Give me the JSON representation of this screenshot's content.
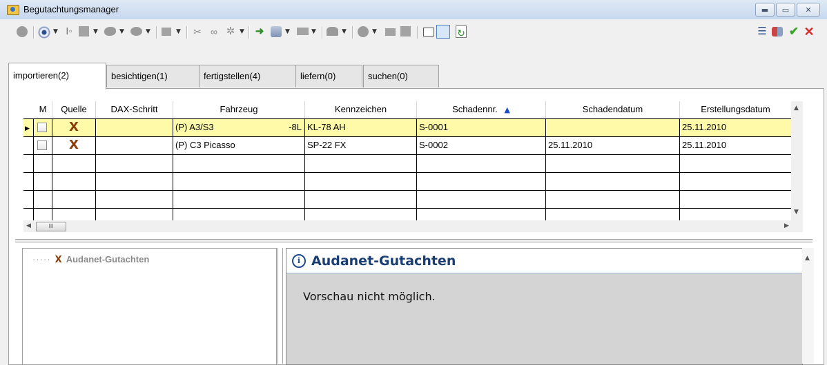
{
  "window": {
    "title": "Begutachtungsmanager",
    "buttons": [
      "minimize",
      "maximize",
      "close"
    ]
  },
  "tabs": [
    {
      "label": "importieren(2)",
      "active": true
    },
    {
      "label": "besichtigen(1)",
      "active": false
    },
    {
      "label": "fertigstellen(4)",
      "active": false
    },
    {
      "label": "liefern(0)",
      "active": false
    },
    {
      "label": "suchen(0)",
      "active": false
    }
  ],
  "grid": {
    "columns": [
      "M",
      "Quelle",
      "DAX-Schritt",
      "Fahrzeug",
      "Kennzeichen",
      "Schadennr.",
      "Schadendatum",
      "Erstellungsdatum"
    ],
    "sort_column": "Schadennr.",
    "sort_direction": "ascending",
    "rows": [
      {
        "selected": true,
        "m": false,
        "quelle": "X",
        "dax": "",
        "fahrzeug": "(P) A3/S3",
        "fahrzeug_suffix": "-8L",
        "kennzeichen": "KL-78 AH",
        "schadennr": "S-0001",
        "schadendatum": "",
        "erstellungsdatum": "25.11.2010"
      },
      {
        "selected": false,
        "m": false,
        "quelle": "X",
        "dax": "",
        "fahrzeug": "(P) C3 Picasso",
        "fahrzeug_suffix": "",
        "kennzeichen": "SP-22 FX",
        "schadennr": "S-0002",
        "schadendatum": "25.11.2010",
        "erstellungsdatum": "25.11.2010"
      }
    ],
    "hscroll_thumb": "III"
  },
  "tree": {
    "item": "Audanet-Gutachten",
    "icon": "x-source-icon"
  },
  "preview": {
    "title": "Audanet-Gutachten",
    "message": "Vorschau nicht möglich."
  },
  "colors": {
    "selected_row": "#fffaa8",
    "preview_title": "#1a3d73",
    "source_icon": "#8b3c06",
    "check_green": "#3aa52b",
    "cancel_red": "#d42a2a"
  }
}
